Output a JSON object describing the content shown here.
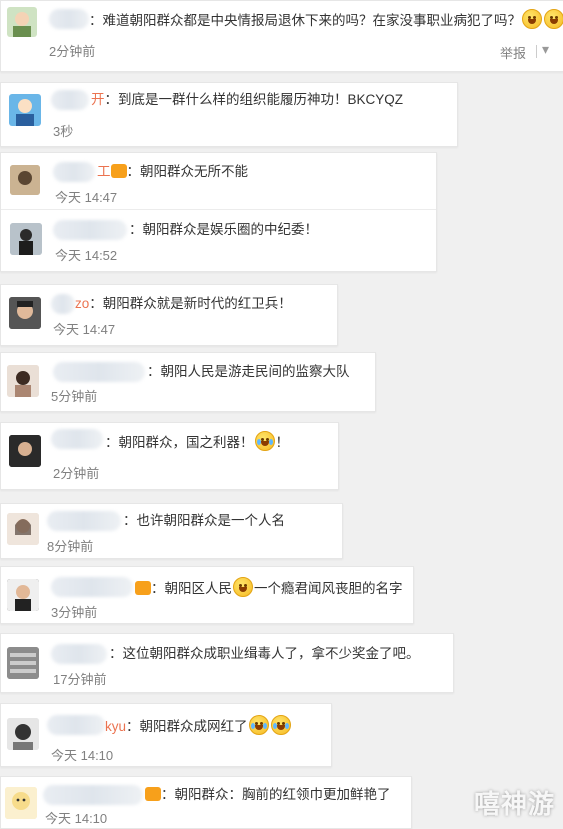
{
  "comments": [
    {
      "text": "：难道朝阳群众都是中央情报局退休下来的吗？在家没事职业病犯了吗？",
      "time": "2分钟前",
      "name_suffix": ""
    },
    {
      "text": "：到底是一群什么样的组织能履历神功！BKCYQZ",
      "time": "3秒",
      "name_suffix": "开"
    },
    {
      "text": "：朝阳群众无所不能",
      "time": "今天 14:47",
      "name_suffix": "工"
    },
    {
      "text": "：朝阳群众是娱乐圈的中纪委！",
      "time": "今天 14:52",
      "name_suffix": ""
    },
    {
      "text": "：朝阳群众就是新时代的红卫兵！",
      "time": "今天 14:47",
      "name_suffix": "zo"
    },
    {
      "text": "：朝阳人民是游走民间的监察大队",
      "time": "5分钟前",
      "name_suffix": ""
    },
    {
      "text": "：朝阳群众，国之利器！",
      "text_end": "！",
      "time": "2分钟前",
      "name_suffix": ""
    },
    {
      "text": "：也许朝阳群众是一个人名",
      "time": "8分钟前",
      "name_suffix": ""
    },
    {
      "text": "：朝阳区人民",
      "text_end": "一个瘾君闻风丧胆的名字",
      "time": "3分钟前",
      "name_suffix": ""
    },
    {
      "text": "：这位朝阳群众成职业缉毒人了，拿不少奖金了吧。",
      "time": "17分钟前",
      "name_suffix": ""
    },
    {
      "text": "：朝阳群众成网红了",
      "time": "今天 14:10",
      "name_suffix": "kyu"
    },
    {
      "text": "：朝阳群众：胸前的红领巾更加鲜艳了",
      "time": "今天 14:10",
      "name_suffix": ""
    }
  ],
  "report_label": "举报",
  "watermark": "嘻神游",
  "icons": {
    "emoji": "emoji-icon",
    "vip": "vip-badge-icon"
  }
}
